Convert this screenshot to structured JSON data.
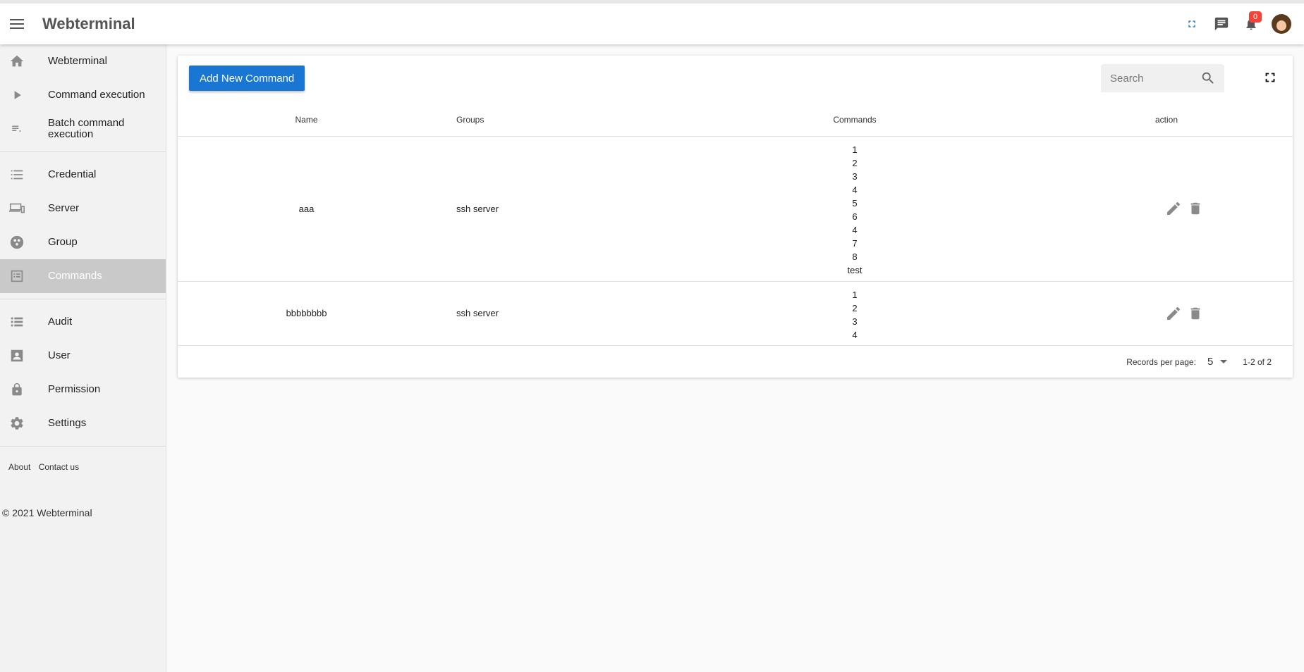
{
  "app": {
    "title": "Webterminal"
  },
  "header": {
    "notification_count": "0"
  },
  "sidebar": {
    "groups": [
      [
        {
          "label": "Webterminal",
          "icon": "home-icon"
        },
        {
          "label": "Command execution",
          "icon": "play-icon"
        },
        {
          "label": "Batch command execution",
          "icon": "playlist-icon"
        }
      ],
      [
        {
          "label": "Credential",
          "icon": "list-icon"
        },
        {
          "label": "Server",
          "icon": "devices-icon"
        },
        {
          "label": "Group",
          "icon": "group-icon"
        },
        {
          "label": "Commands",
          "icon": "commands-icon",
          "active": true
        }
      ],
      [
        {
          "label": "Audit",
          "icon": "audit-list-icon"
        },
        {
          "label": "User",
          "icon": "user-icon"
        },
        {
          "label": "Permission",
          "icon": "lock-icon"
        },
        {
          "label": "Settings",
          "icon": "gear-icon"
        }
      ]
    ],
    "footer": {
      "about": "About",
      "contact": "Contact us",
      "copyright": "© 2021 Webterminal"
    }
  },
  "toolbar": {
    "add_label": "Add New Command",
    "search_placeholder": "Search"
  },
  "table": {
    "columns": [
      "Name",
      "Groups",
      "Commands",
      "action"
    ],
    "rows": [
      {
        "name": "aaa",
        "groups": "ssh server",
        "commands": [
          "1",
          "2",
          "3",
          "4",
          "5",
          "6",
          "4",
          "7",
          "8",
          "test"
        ]
      },
      {
        "name": "bbbbbbbb",
        "groups": "ssh server",
        "commands": [
          "1",
          "2",
          "3",
          "4"
        ]
      }
    ]
  },
  "pagination": {
    "label": "Records per page:",
    "per_page": "5",
    "range": "1-2 of 2"
  },
  "colors": {
    "primary": "#1976d2",
    "badge": "#f44336",
    "active_nav": "#c9c9c9"
  }
}
